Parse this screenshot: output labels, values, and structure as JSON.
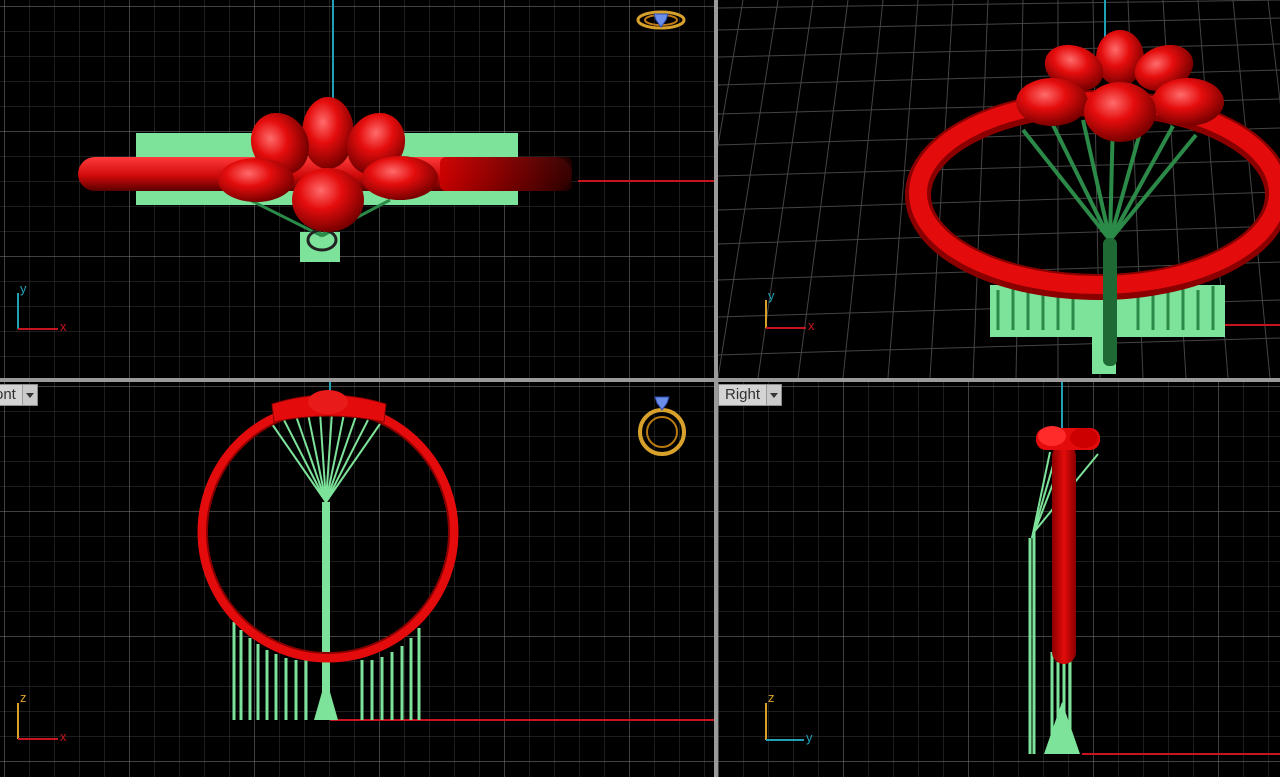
{
  "viewports": {
    "top": {
      "label": ""
    },
    "perspective": {
      "label": ""
    },
    "front": {
      "label": "ont"
    },
    "right": {
      "label": "Right"
    }
  },
  "axes": {
    "top": {
      "vertical": "y",
      "horizontal": "x"
    },
    "perspective": {
      "vertical": "y",
      "horizontal": "x"
    },
    "front": {
      "vertical": "z",
      "horizontal": "x"
    },
    "right": {
      "vertical": "z",
      "horizontal": "y"
    }
  },
  "icons": {
    "top_widget": "ring-widget-icon",
    "front_widget": "ring-widget-icon"
  },
  "colors": {
    "background": "#000000",
    "grid": "#3d3d3d",
    "grid_major": "#6a6a6a",
    "ring": "#e30b0b",
    "support": "#7de39a",
    "axis_x": "#c8141e",
    "axis_y": "#21a0b5",
    "gizmo": "#d8a12b"
  }
}
